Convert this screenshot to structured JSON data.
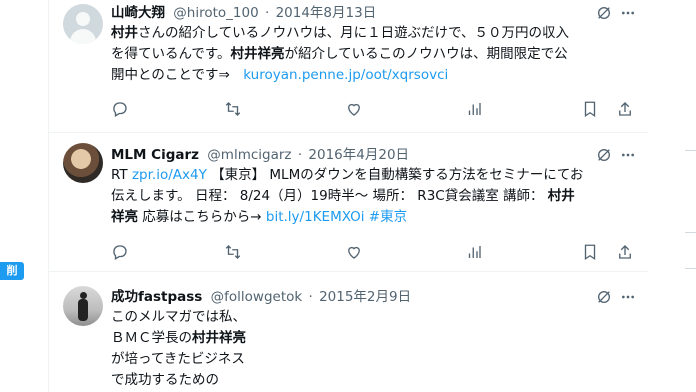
{
  "left_badge": "削",
  "tweets": [
    {
      "name": "山崎大翔",
      "handle": "@hiroto_100",
      "sep": "·",
      "date": "2014年8月13日",
      "lines": [
        {
          "segments": [
            {
              "t": "村井",
              "b": true
            },
            {
              "t": "さんの紹介しているノウハウは、月に１日遊ぶだけで、５０万円の収入"
            }
          ]
        },
        {
          "segments": [
            {
              "t": "を得ているんです。"
            },
            {
              "t": "村井祥亮",
              "b": true
            },
            {
              "t": "が紹介しているこのノウハウは、期間限定で公"
            }
          ]
        },
        {
          "segments": [
            {
              "t": "開中とのことです⇒　"
            },
            {
              "t": "kuroyan.penne.jp/oot/xqrsovci",
              "l": true
            }
          ]
        }
      ]
    },
    {
      "name": "MLM Cigarz",
      "handle": "@mlmcigarz",
      "sep": "·",
      "date": "2016年4月20日",
      "lines": [
        {
          "segments": [
            {
              "t": "RT "
            },
            {
              "t": "zpr.io/Ax4Y",
              "l": true
            },
            {
              "t": " 【東京】 MLMのダウンを自動構築する方法をセミナーにてお"
            }
          ]
        },
        {
          "segments": [
            {
              "t": "伝えします。 日程： 8/24（月）19時半〜 場所： R3C貸会議室 講師： "
            },
            {
              "t": "村井",
              "b": true
            }
          ]
        },
        {
          "segments": [
            {
              "t": "祥亮",
              "b": true
            },
            {
              "t": " 応募はこちらから→ "
            },
            {
              "t": "bit.ly/1KEMXOi",
              "l": true
            },
            {
              "t": " "
            },
            {
              "t": "#東京",
              "l": true
            }
          ]
        }
      ]
    },
    {
      "name": "成功fastpass",
      "handle": "@followgetok",
      "sep": "·",
      "date": "2015年2月9日",
      "lines": [
        {
          "segments": [
            {
              "t": "このメルマガでは私、"
            }
          ]
        },
        {
          "segments": [
            {
              "t": "ＢＭＣ学長の"
            },
            {
              "t": "村井祥亮",
              "b": true
            }
          ]
        },
        {
          "segments": [
            {
              "t": "が培ってきたビジネス"
            }
          ]
        },
        {
          "segments": [
            {
              "t": "で成功するための"
            }
          ]
        }
      ]
    }
  ],
  "icons": {
    "grok": "grok-slash-icon",
    "more": "more-dots-icon",
    "reply": "reply-bubble-icon",
    "retweet": "retweet-icon",
    "like": "heart-icon",
    "views": "bar-chart-icon",
    "bookmark": "bookmark-icon",
    "share": "share-icon"
  },
  "colors": {
    "link": "#1d9bf0",
    "meta": "#536471",
    "border": "#eff3f4"
  }
}
